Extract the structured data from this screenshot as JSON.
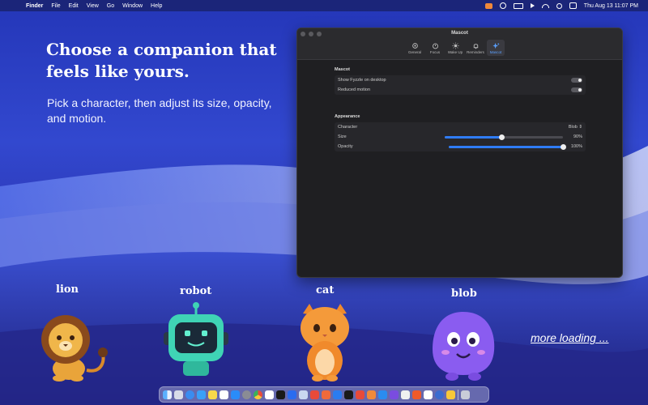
{
  "menubar": {
    "apple": "",
    "app": "Finder",
    "items": [
      "File",
      "Edit",
      "View",
      "Go",
      "Window",
      "Help"
    ],
    "clock": "Thu Aug 13  11:07 PM"
  },
  "hero": {
    "title": "Choose a companion that feels like yours.",
    "subtitle": "Pick a character, then adjust its size, opacity, and motion."
  },
  "window": {
    "title": "Mascot",
    "tabs": [
      {
        "label": "General",
        "icon": "gear-icon"
      },
      {
        "label": "Focus",
        "icon": "timer-icon"
      },
      {
        "label": "Wake Up",
        "icon": "sun-icon"
      },
      {
        "label": "Reminders",
        "icon": "bell-icon"
      },
      {
        "label": "Mascot",
        "icon": "sparkle-icon",
        "active": true
      }
    ],
    "mascot_section": {
      "title": "Mascot",
      "show_on_desktop": "Show Fyzzle on desktop",
      "reduced_motion": "Reduced motion"
    },
    "appearance_section": {
      "title": "Appearance",
      "character_label": "Character",
      "character_value": "Blob",
      "size_label": "Size",
      "size_value": "90%",
      "size_fraction": 0.48,
      "opacity_label": "Opacity",
      "opacity_value": "100%",
      "opacity_fraction": 1.0
    }
  },
  "characters": [
    {
      "name": "lion"
    },
    {
      "name": "robot"
    },
    {
      "name": "cat"
    },
    {
      "name": "blob"
    }
  ],
  "more_loading": "more loading ...",
  "colors": {
    "accent": "#2f7cf6",
    "lion": "#e9a43a",
    "robot": "#3fd4b5",
    "cat": "#f08a2c",
    "blob": "#8a5cf0"
  }
}
